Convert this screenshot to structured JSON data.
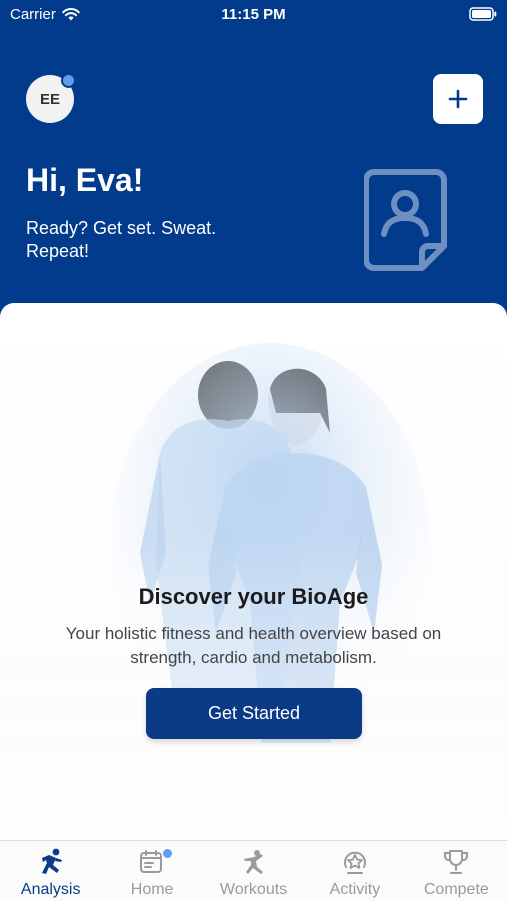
{
  "status_bar": {
    "carrier": "Carrier",
    "time": "11:15 PM"
  },
  "header": {
    "avatar_initials": "EE",
    "greeting": "Hi, Eva!",
    "tagline": "Ready? Get set. Sweat. Repeat!"
  },
  "card": {
    "title": "Discover your BioAge",
    "description": "Your holistic fitness and health overview based on strength, cardio and metabolism.",
    "cta_label": "Get Started"
  },
  "tabs": [
    {
      "label": "Analysis",
      "icon": "runner-icon",
      "active": true
    },
    {
      "label": "Home",
      "icon": "calendar-icon",
      "badge": true
    },
    {
      "label": "Workouts",
      "icon": "workout-icon"
    },
    {
      "label": "Activity",
      "icon": "star-badge-icon"
    },
    {
      "label": "Compete",
      "icon": "trophy-icon"
    }
  ],
  "colors": {
    "brand": "#023b8c",
    "button": "#0b3a87",
    "badge": "#5aa0e6",
    "inactive": "#9a9a9a"
  }
}
